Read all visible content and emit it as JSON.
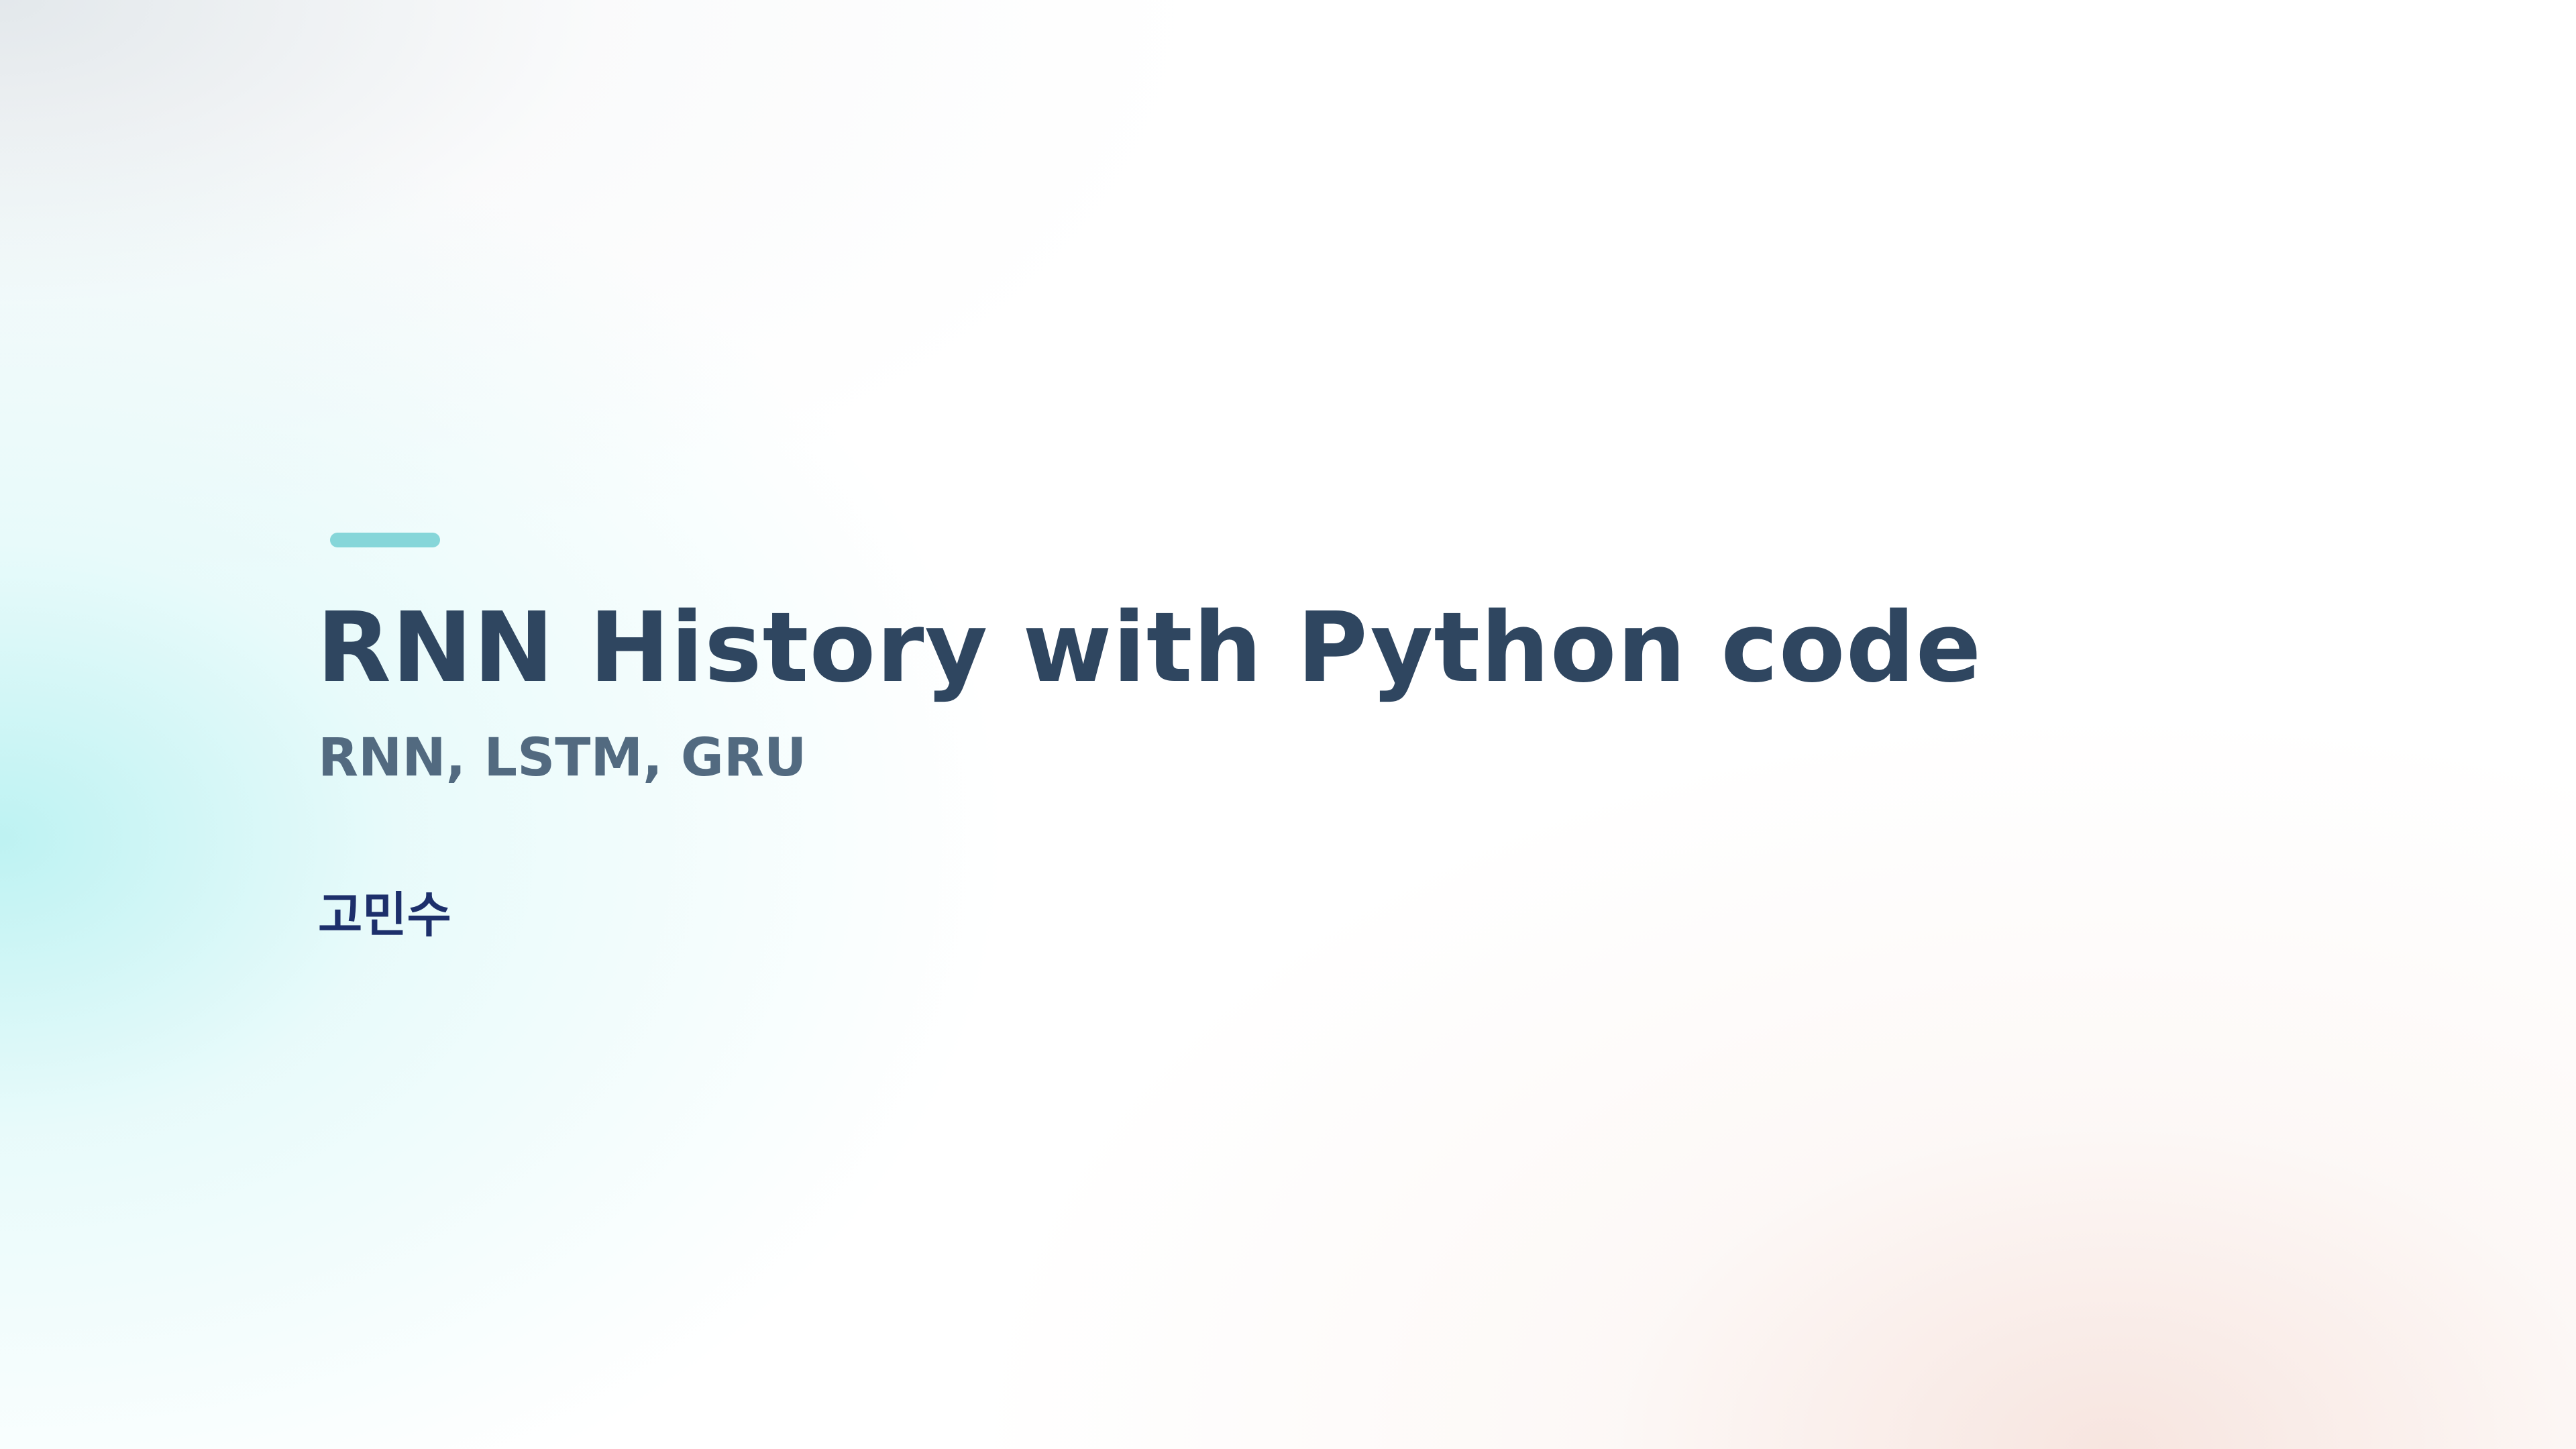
{
  "slide": {
    "title": "RNN History with Python code",
    "subtitle": "RNN, LSTM, GRU",
    "author": "고민수"
  },
  "colors": {
    "accent": "#86d6d9",
    "title": "#2f4660",
    "subtitle": "#526a80",
    "author": "#1d2f6b"
  }
}
